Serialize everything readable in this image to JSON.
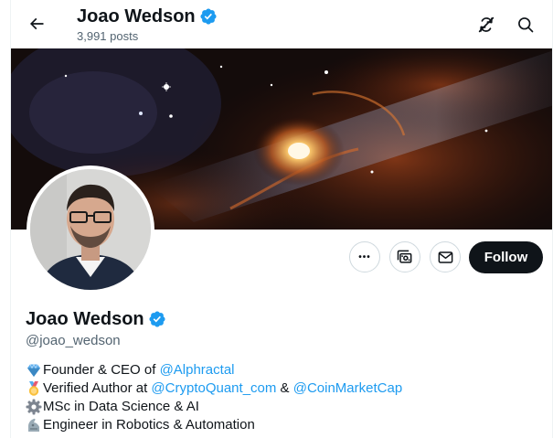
{
  "header": {
    "name": "Joao Wedson",
    "posts": "3,991 posts"
  },
  "profile": {
    "name": "Joao Wedson",
    "handle": "@joao_wedson"
  },
  "actions": {
    "follow_label": "Follow",
    "more_symbol": "•••"
  },
  "bio": {
    "line1": {
      "prefix": "Founder & CEO of ",
      "link1": "@Alphractal"
    },
    "line2": {
      "prefix": "Verified Author at ",
      "link1": "@CryptoQuant_com",
      "middle": " & ",
      "link2": "@CoinMarketCap"
    },
    "line3": {
      "text": "MSc in Data Science & AI"
    },
    "line4": {
      "text": "Engineer in Robotics & Automation"
    }
  },
  "icons": {
    "back": "back-arrow-icon",
    "verified": "verified-badge-icon",
    "broken_link": "broken-link-icon",
    "search": "search-icon",
    "more": "more-icon",
    "subscribe": "subscribe-icon",
    "message": "message-icon",
    "diamond": "diamond-emoji",
    "medal": "medal-emoji",
    "gear": "gear-emoji",
    "arm": "mechanical-arm-emoji"
  },
  "colors": {
    "accent": "#1d9bf0",
    "text": "#0f1419",
    "muted": "#536471",
    "follow_bg": "#0f1419"
  }
}
